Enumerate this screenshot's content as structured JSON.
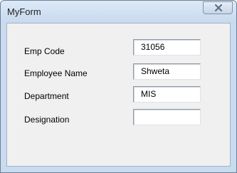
{
  "window": {
    "title": "MyForm"
  },
  "form": {
    "fields": [
      {
        "label": "Emp Code",
        "value": "31056"
      },
      {
        "label": "Employee Name",
        "value": "Shweta"
      },
      {
        "label": "Department",
        "value": "MIS"
      },
      {
        "label": "Designation",
        "value": ""
      }
    ]
  }
}
